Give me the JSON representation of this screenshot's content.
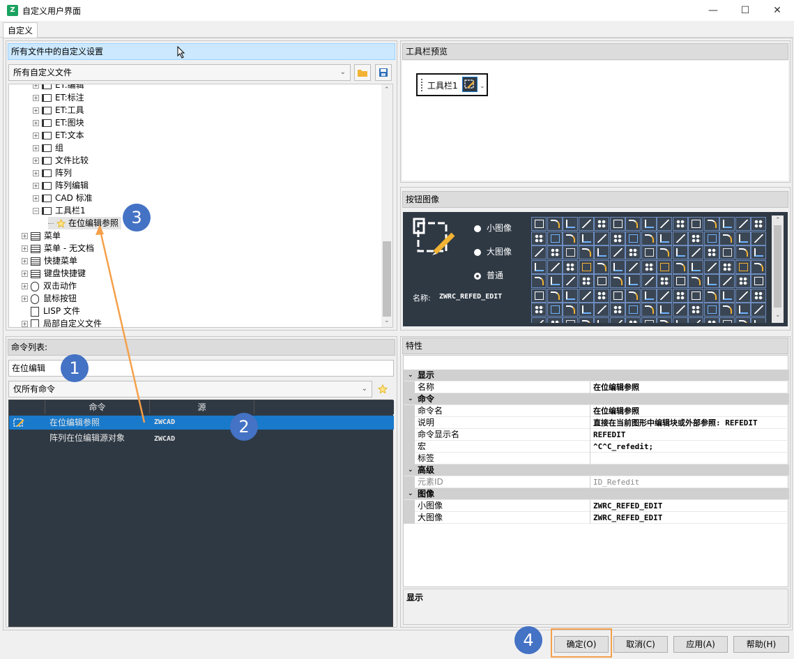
{
  "window": {
    "title": "自定义用户界面",
    "minimize": "—",
    "maximize": "☐",
    "close": "✕"
  },
  "tabs": [
    {
      "label": "自定义"
    }
  ],
  "left_top": {
    "header": "所有文件中的自定义设置",
    "combo_value": "所有自定义文件",
    "tree": [
      {
        "label": "ET:编辑",
        "indent": 2,
        "icon": "toolbar"
      },
      {
        "label": "ET:标注",
        "indent": 2,
        "icon": "toolbar"
      },
      {
        "label": "ET:工具",
        "indent": 2,
        "icon": "toolbar"
      },
      {
        "label": "ET:图块",
        "indent": 2,
        "icon": "toolbar"
      },
      {
        "label": "ET:文本",
        "indent": 2,
        "icon": "toolbar"
      },
      {
        "label": "组",
        "indent": 2,
        "icon": "toolbar"
      },
      {
        "label": "文件比较",
        "indent": 2,
        "icon": "toolbar"
      },
      {
        "label": "阵列",
        "indent": 2,
        "icon": "toolbar"
      },
      {
        "label": "阵列编辑",
        "indent": 2,
        "icon": "toolbar"
      },
      {
        "label": "CAD 标准",
        "indent": 2,
        "icon": "toolbar"
      },
      {
        "label": "工具栏1",
        "indent": 2,
        "icon": "toolbar",
        "expanded": true
      },
      {
        "label": "在位编辑参照",
        "indent": 3,
        "icon": "star"
      },
      {
        "label": "菜单",
        "indent": 1,
        "icon": "menu"
      },
      {
        "label": "菜单 - 无文档",
        "indent": 1,
        "icon": "menu"
      },
      {
        "label": "快捷菜单",
        "indent": 1,
        "icon": "menu"
      },
      {
        "label": "键盘快捷键",
        "indent": 1,
        "icon": "menu"
      },
      {
        "label": "双击动作",
        "indent": 1,
        "icon": "mouse"
      },
      {
        "label": "鼠标按钮",
        "indent": 1,
        "icon": "mouse"
      },
      {
        "label": "LISP  文件",
        "indent": 1,
        "icon": "file",
        "noexp": true
      },
      {
        "label": "局部自定义文件",
        "indent": 1,
        "icon": "file"
      }
    ]
  },
  "command_list": {
    "header": "命令列表:",
    "search_value": "在位编辑",
    "filter_value": "仅所有命令",
    "columns": [
      "命令",
      "源"
    ],
    "rows": [
      {
        "name": "在位编辑参照",
        "source": "ZWCAD",
        "selected": true
      },
      {
        "name": "阵列在位编辑源对象",
        "source": "ZWCAD",
        "selected": false
      }
    ]
  },
  "toolbar_preview": {
    "header": "工具栏预览",
    "toolbar_name": "工具栏1"
  },
  "button_image": {
    "header": "按钮图像",
    "options": [
      {
        "label": "小图像",
        "checked": false
      },
      {
        "label": "大图像",
        "checked": false
      },
      {
        "label": "普通",
        "checked": true
      }
    ],
    "name_label": "名称:",
    "name_value": "ZWRC_REFED_EDIT"
  },
  "properties": {
    "header": "特性",
    "rows": [
      {
        "type": "cat",
        "name": "显示"
      },
      {
        "type": "prop",
        "name": "名称",
        "value": "在位编辑参照"
      },
      {
        "type": "cat",
        "name": "命令"
      },
      {
        "type": "prop",
        "name": "命令名",
        "value": "在位编辑参照"
      },
      {
        "type": "prop",
        "name": "说明",
        "value": "直接在当前图形中编辑块或外部参照: REFEDIT"
      },
      {
        "type": "prop",
        "name": "命令显示名",
        "value": "REFEDIT"
      },
      {
        "type": "prop",
        "name": "宏",
        "value": "^C^C_refedit;"
      },
      {
        "type": "prop",
        "name": "标签",
        "value": ""
      },
      {
        "type": "cat",
        "name": "高级"
      },
      {
        "type": "prop",
        "name": "元素ID",
        "value": "ID_Refedit",
        "disabled": true
      },
      {
        "type": "cat",
        "name": "图像"
      },
      {
        "type": "prop",
        "name": "小图像",
        "value": "ZWRC_REFED_EDIT"
      },
      {
        "type": "prop",
        "name": "大图像",
        "value": "ZWRC_REFED_EDIT"
      }
    ],
    "description_title": "显示"
  },
  "buttons": {
    "ok": "确定(O)",
    "cancel": "取消(C)",
    "apply": "应用(A)",
    "help": "帮助(H)"
  },
  "badges": [
    "1",
    "2",
    "3",
    "4"
  ],
  "colors": {
    "selection": "#1979ca",
    "badge": "#4472c4",
    "callout": "#f5a04a",
    "dark_panel": "#2f3944"
  }
}
